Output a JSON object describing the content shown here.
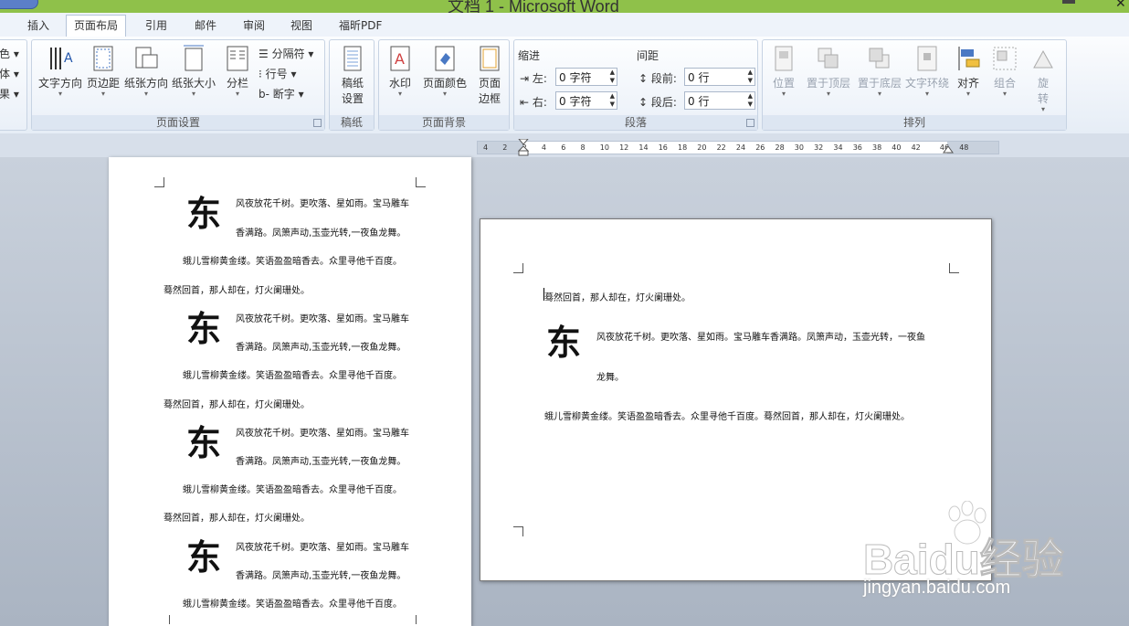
{
  "window": {
    "title": "文档 1 - Microsoft Word",
    "close_glyph": "✕"
  },
  "tabs": [
    {
      "label": "插入",
      "active": false
    },
    {
      "label": "页面布局",
      "active": true
    },
    {
      "label": "引用",
      "active": false
    },
    {
      "label": "邮件",
      "active": false
    },
    {
      "label": "审阅",
      "active": false
    },
    {
      "label": "视图",
      "active": false
    },
    {
      "label": "福昕PDF",
      "active": false
    }
  ],
  "ribbon": {
    "theme_partial": [
      "色",
      "体",
      "果"
    ],
    "page_setup": {
      "label": "页面设置",
      "buttons": [
        "文字方向",
        "页边距",
        "纸张方向",
        "纸张大小",
        "分栏"
      ],
      "small": [
        "分隔符",
        "行号",
        "断字"
      ]
    },
    "manuscript": {
      "label": "稿纸",
      "button_line1": "稿纸",
      "button_line2": "设置"
    },
    "page_background": {
      "label": "页面背景",
      "buttons": [
        "水印",
        "页面颜色"
      ],
      "border_line1": "页面",
      "border_line2": "边框"
    },
    "paragraph": {
      "label": "段落",
      "indent_title": "缩进",
      "spacing_title": "间距",
      "left_label": "左:",
      "right_label": "右:",
      "left_value": "0 字符",
      "right_value": "0 字符",
      "before_label": "段前:",
      "after_label": "段后:",
      "before_value": "0 行",
      "after_value": "0 行"
    },
    "arrange": {
      "label": "排列",
      "buttons": [
        "位置",
        "置于顶层",
        "置于底层",
        "文字环绕",
        "对齐",
        "组合"
      ],
      "rotate_line1": "旋",
      "rotate_line2": "转"
    }
  },
  "ruler": {
    "ticks": [
      "4",
      "2",
      "2",
      "4",
      "6",
      "8",
      "10",
      "12",
      "14",
      "16",
      "18",
      "20",
      "22",
      "24",
      "26",
      "28",
      "30",
      "32",
      "34",
      "36",
      "38",
      "40",
      "42",
      "46",
      "48"
    ]
  },
  "document": {
    "dropcap": "东",
    "line_a": "风夜放花千树。更吹落、星如雨。宝马雕车",
    "line_b": "香满路。凤箫声动,玉壶光转,一夜鱼龙舞。",
    "line_c": "蛾儿雪柳黄金缕。笑语盈盈暗香去。众里寻他千百度。",
    "line_d": "蓦然回首，那人却在，灯火阑珊处。",
    "p2_line1": "蓦然回首，那人却在，灯火阑珊处。",
    "p2_line2": "风夜放花千树。更吹落、星如雨。宝马雕车香满路。凤箫声动，玉壶光转，一夜鱼",
    "p2_line3": "龙舞。",
    "p2_line4": "蛾儿雪柳黄金缕。笑语盈盈暗香去。众里寻他千百度。蓦然回首，那人却在，灯火阑珊处。"
  },
  "watermark": {
    "brand": "Baidu经验",
    "url": "jingyan.baidu.com"
  }
}
